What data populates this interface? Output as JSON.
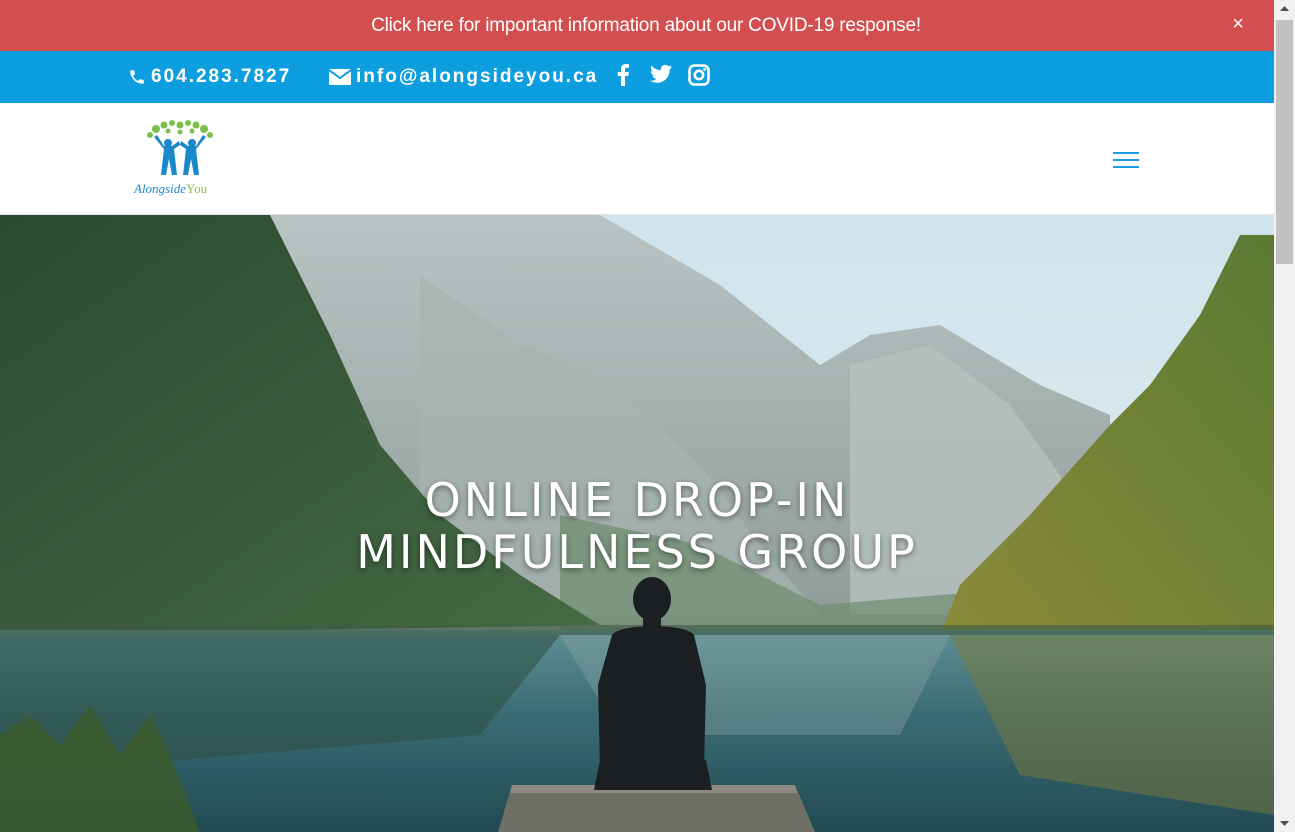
{
  "alert": {
    "text": "Click here for important information about our COVID-19 response!",
    "close_label": "×"
  },
  "topbar": {
    "phone": "604.283.7827",
    "email": "info@alongsideyou.ca",
    "social": [
      "facebook-icon",
      "twitter-icon",
      "instagram-icon"
    ]
  },
  "header": {
    "logo": {
      "part1": "Alongside",
      "part2": "You"
    },
    "menu_icon": "hamburger-menu-icon"
  },
  "hero": {
    "title_line1": "ONLINE DROP-IN",
    "title_line2": "MINDFULNESS GROUP"
  },
  "colors": {
    "alert_bg": "#d34f4f",
    "topbar_bg": "#0d9ee0",
    "accent": "#1c9be0"
  }
}
